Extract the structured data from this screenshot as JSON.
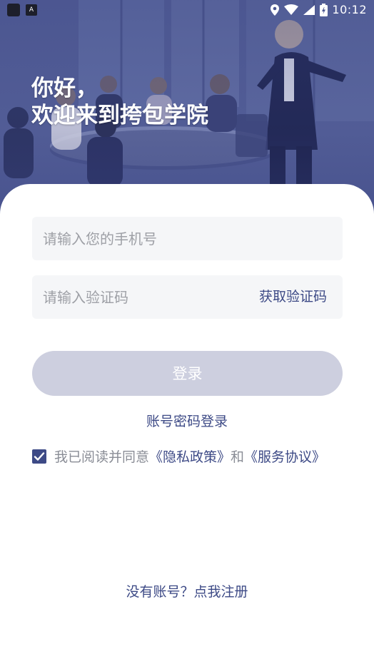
{
  "status_bar": {
    "time": "10:12",
    "icons": [
      "app-icon",
      "a-icon",
      "location-icon",
      "wifi-icon",
      "signal-icon",
      "battery-icon"
    ]
  },
  "greeting": {
    "line1": "你好，",
    "line2": "欢迎来到挎包学院"
  },
  "form": {
    "phone_placeholder": "请输入您的手机号",
    "code_placeholder": "请输入验证码",
    "get_code_label": "获取验证码",
    "login_label": "登录",
    "password_login_label": "账号密码登录"
  },
  "agreement": {
    "checked": true,
    "prefix": "我已阅读并同意",
    "privacy_link": "《隐私政策》",
    "conjunction": "和",
    "service_link": "《服务协议》"
  },
  "footer": {
    "register_label": "没有账号？点我注册"
  },
  "colors": {
    "accent": "#3d4a86",
    "hero": "#4a5590",
    "button_disabled": "#cdcfdf",
    "field_bg": "#f5f6f8",
    "muted_text": "#8a8d96"
  }
}
